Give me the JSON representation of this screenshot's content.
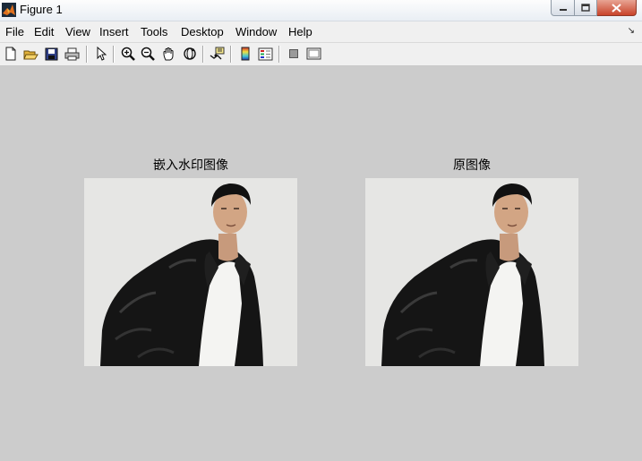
{
  "window": {
    "title": "Figure 1"
  },
  "menu": {
    "items": [
      "File",
      "Edit",
      "View",
      "Insert",
      "Tools",
      "Desktop",
      "Window",
      "Help"
    ]
  },
  "toolbar": {
    "buttons": [
      "new-figure",
      "open-file",
      "save-figure",
      "print-figure",
      "edit-plot",
      "zoom-in",
      "zoom-out",
      "pan",
      "rotate-3d",
      "data-cursor",
      "insert-colorbar",
      "insert-legend",
      "hide-plot-tools",
      "show-plot-tools"
    ]
  },
  "axes": [
    {
      "title": "嵌入水印图像"
    },
    {
      "title": "原图像"
    }
  ],
  "colors": {
    "figure_background": "#cccccc",
    "photo_background": "#e4e4e2"
  }
}
